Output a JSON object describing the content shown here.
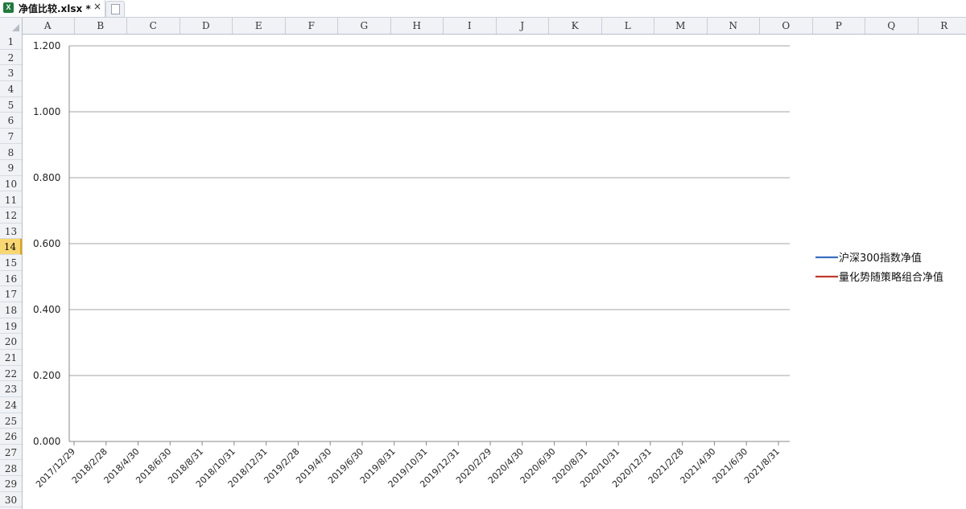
{
  "tabs": {
    "file_label": "净值比较.xlsx *",
    "close_glyph": "×",
    "excel_icon_letter": "X"
  },
  "columns": [
    "A",
    "B",
    "C",
    "D",
    "E",
    "F",
    "G",
    "H",
    "I",
    "J",
    "K",
    "L",
    "M",
    "N",
    "O",
    "P",
    "Q",
    "R"
  ],
  "rows": [
    "1",
    "2",
    "3",
    "4",
    "5",
    "6",
    "7",
    "8",
    "9",
    "10",
    "11",
    "12",
    "13",
    "14",
    "15",
    "16",
    "17",
    "18",
    "19",
    "20",
    "21",
    "22",
    "23",
    "24",
    "25",
    "26",
    "27",
    "28",
    "29",
    "30"
  ],
  "active_row": "14",
  "colors": {
    "series_1": "#3a6fc0",
    "series_2": "#c0392b",
    "gridline": "#a6a6a6",
    "active_row_bg": "#f8d773"
  },
  "chart_data": {
    "type": "line",
    "title": "",
    "xlabel": "",
    "ylabel": "",
    "ylim": [
      0,
      1.2
    ],
    "y_ticks": [
      "0.000",
      "0.200",
      "0.400",
      "0.600",
      "0.800",
      "1.000",
      "1.200"
    ],
    "categories": [
      "2017/12/29",
      "2018/2/28",
      "2018/4/30",
      "2018/6/30",
      "2018/8/31",
      "2018/10/31",
      "2018/12/31",
      "2019/2/28",
      "2019/4/30",
      "2019/6/30",
      "2019/8/31",
      "2019/10/31",
      "2019/12/31",
      "2020/2/29",
      "2020/4/30",
      "2020/6/30",
      "2020/8/31",
      "2020/10/31",
      "2020/12/31",
      "2021/2/28",
      "2021/4/30",
      "2021/6/30",
      "2021/8/31"
    ],
    "series": [
      {
        "name": "沪深300指数净值",
        "values": []
      },
      {
        "name": "量化势随策略组合净值",
        "values": []
      }
    ],
    "grid": true,
    "legend_position": "right"
  }
}
